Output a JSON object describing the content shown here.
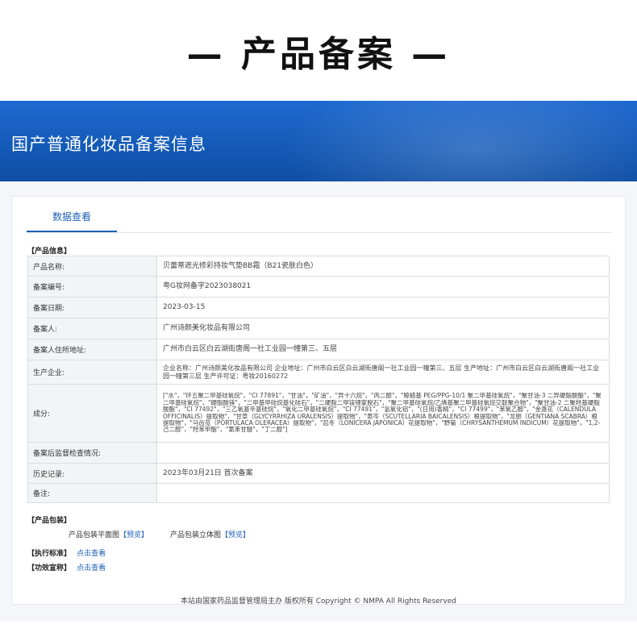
{
  "page_heading": "— 产品备案 —",
  "banner": {
    "title": "国产普通化妆品备案信息"
  },
  "tab": {
    "label": "数据查看"
  },
  "product_info": {
    "section_label": "【产品信息】",
    "rows": [
      {
        "label": "产品名称:",
        "value": "贝蕾蒂遮光修彩持妆气垫BB霜（B21瓷肤白色）"
      },
      {
        "label": "备案编号:",
        "value": "粤G妆网备字2023038021"
      },
      {
        "label": "备案日期:",
        "value": "2023-03-15"
      },
      {
        "label": "备案人:",
        "value": "广州诗颜美化妆品有限公司"
      },
      {
        "label": "备案人住所地址:",
        "value": "广州市白云区白云湖街唐阁一社工业园一幢第三、五层"
      },
      {
        "label": "生产企业:",
        "value": "企业名称：广州诗颜美化妆品有限公司 企业地址：广州市白云区白云湖街唐阁一社工业园一幢第三、五层 生产地址：广州市白云区白云湖街唐阁一社工业园一幢第三层 生产许可证：粤妆20160272"
      },
      {
        "label": "成分:",
        "value": "[\"水\"，\"环五聚二甲基硅氧烷\"，\"CI 77891\"，\"甘油\"，\"矿油\"，\"异十六烷\"，\"丙二醇\"，\"鲸蜡基 PEG/PPG-10/1 聚二甲基硅氧烷\"，\"聚甘油-3 二异硬脂酸酯\"，\"聚二甲基硅氧烷\"，\"硬脂酸镁\"，\"二甲基甲硅烷基化硅石\"，\"二硬脂二甲铵锂蒙脱石\"，\"聚二甲基硅氧烷/乙烯基聚二甲基硅氧烷交联聚合物\"，\"聚甘油-2 二聚羟基硬脂酸酯\"，\"CI 77492\"，\"三乙氧基辛基硅烷\"，\"氧化二甲基硅氧烷\"，\"CI 77491\"，\"氢氧化铝\"，\"(日用)香精\"，\"CI 77499\"，\"苯氧乙醇\"，\"金盏花（CALENDULA OFFICINALIS）提取物\"，\"甘草（GLYCYRRHIZA URALENSIS）提取物\"，\"黄芩（SCUTELLARIA BAICALENSIS）根提取物\"，\"龙胆（GENTIANA SCABRA）根提取物\"，\"马齿苋（PORTULACA OLERACEA）提取物\"，\"忍冬（LONICERA JAPONICA）花提取物\"，\"野菊（CHRYSANTHEMUM INDICUM）花提取物\"，\"1,2-己二醇\"，\"羟苯甲酯\"，\"氯苯甘醚\"，\"丁二醇\"]"
      },
      {
        "label": "备案后监督检查情况:",
        "value": ""
      },
      {
        "label": "历史记录:",
        "value": "2023年03月21日 首次备案"
      },
      {
        "label": "备注:",
        "value": ""
      }
    ]
  },
  "packaging": {
    "section_label": "【产品包装】",
    "flat_label": "产品包装平面图",
    "flat_link": "【预览】",
    "solid_label": "产品包装立体图",
    "solid_link": "【预览】"
  },
  "standard": {
    "label": "【执行标准】",
    "link": "点击查看"
  },
  "efficacy": {
    "label": "【功效宣称】",
    "link": "点击查看"
  },
  "footer": {
    "text": "本站由国家药品监督管理局主办 版权所有 Copyright © NMPA All Rights Reserved"
  },
  "colors": {
    "banner": "#1359b6",
    "accent": "#1d5fb8"
  }
}
